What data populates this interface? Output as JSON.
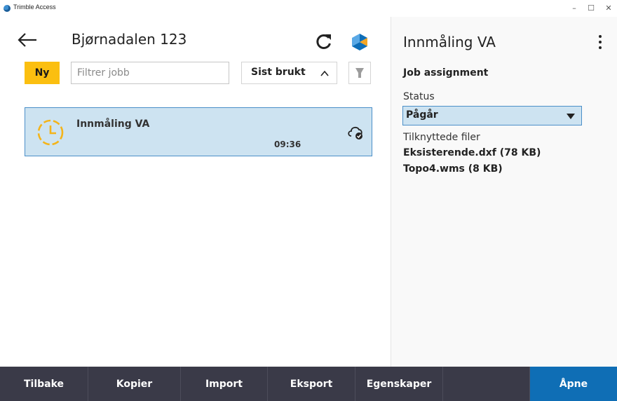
{
  "window": {
    "title": "Trimble Access",
    "minimize": "–",
    "maximize": "☐",
    "close": "✕"
  },
  "header": {
    "project_title": "Bjørnadalen 123"
  },
  "filter_bar": {
    "new_label": "Ny",
    "filter_placeholder": "Filtrer jobb",
    "sort_label": "Sist brukt"
  },
  "jobs": [
    {
      "name": "Innmåling VA",
      "time": "09:36",
      "status_icon": "clock-icon",
      "sync_icon": "cloud-check-icon"
    }
  ],
  "details": {
    "title": "Innmåling VA",
    "section_title": "Job assignment",
    "status_label": "Status",
    "status_value": "Pågår",
    "files_label": "Tilknyttede filer",
    "files": [
      "Eksisterende.dxf (78 KB)",
      "Topo4.wms (8 KB)"
    ]
  },
  "toolbar": {
    "back": "Tilbake",
    "copy": "Kopier",
    "import": "Import",
    "export": "Eksport",
    "properties": "Egenskaper",
    "open": "Åpne"
  },
  "colors": {
    "accent_yellow": "#fbbf10",
    "selection_fill": "#cde3f1",
    "selection_border": "#4b8fc8",
    "toolbar_bg": "#3a3a48",
    "primary_button": "#0f6eb5"
  }
}
